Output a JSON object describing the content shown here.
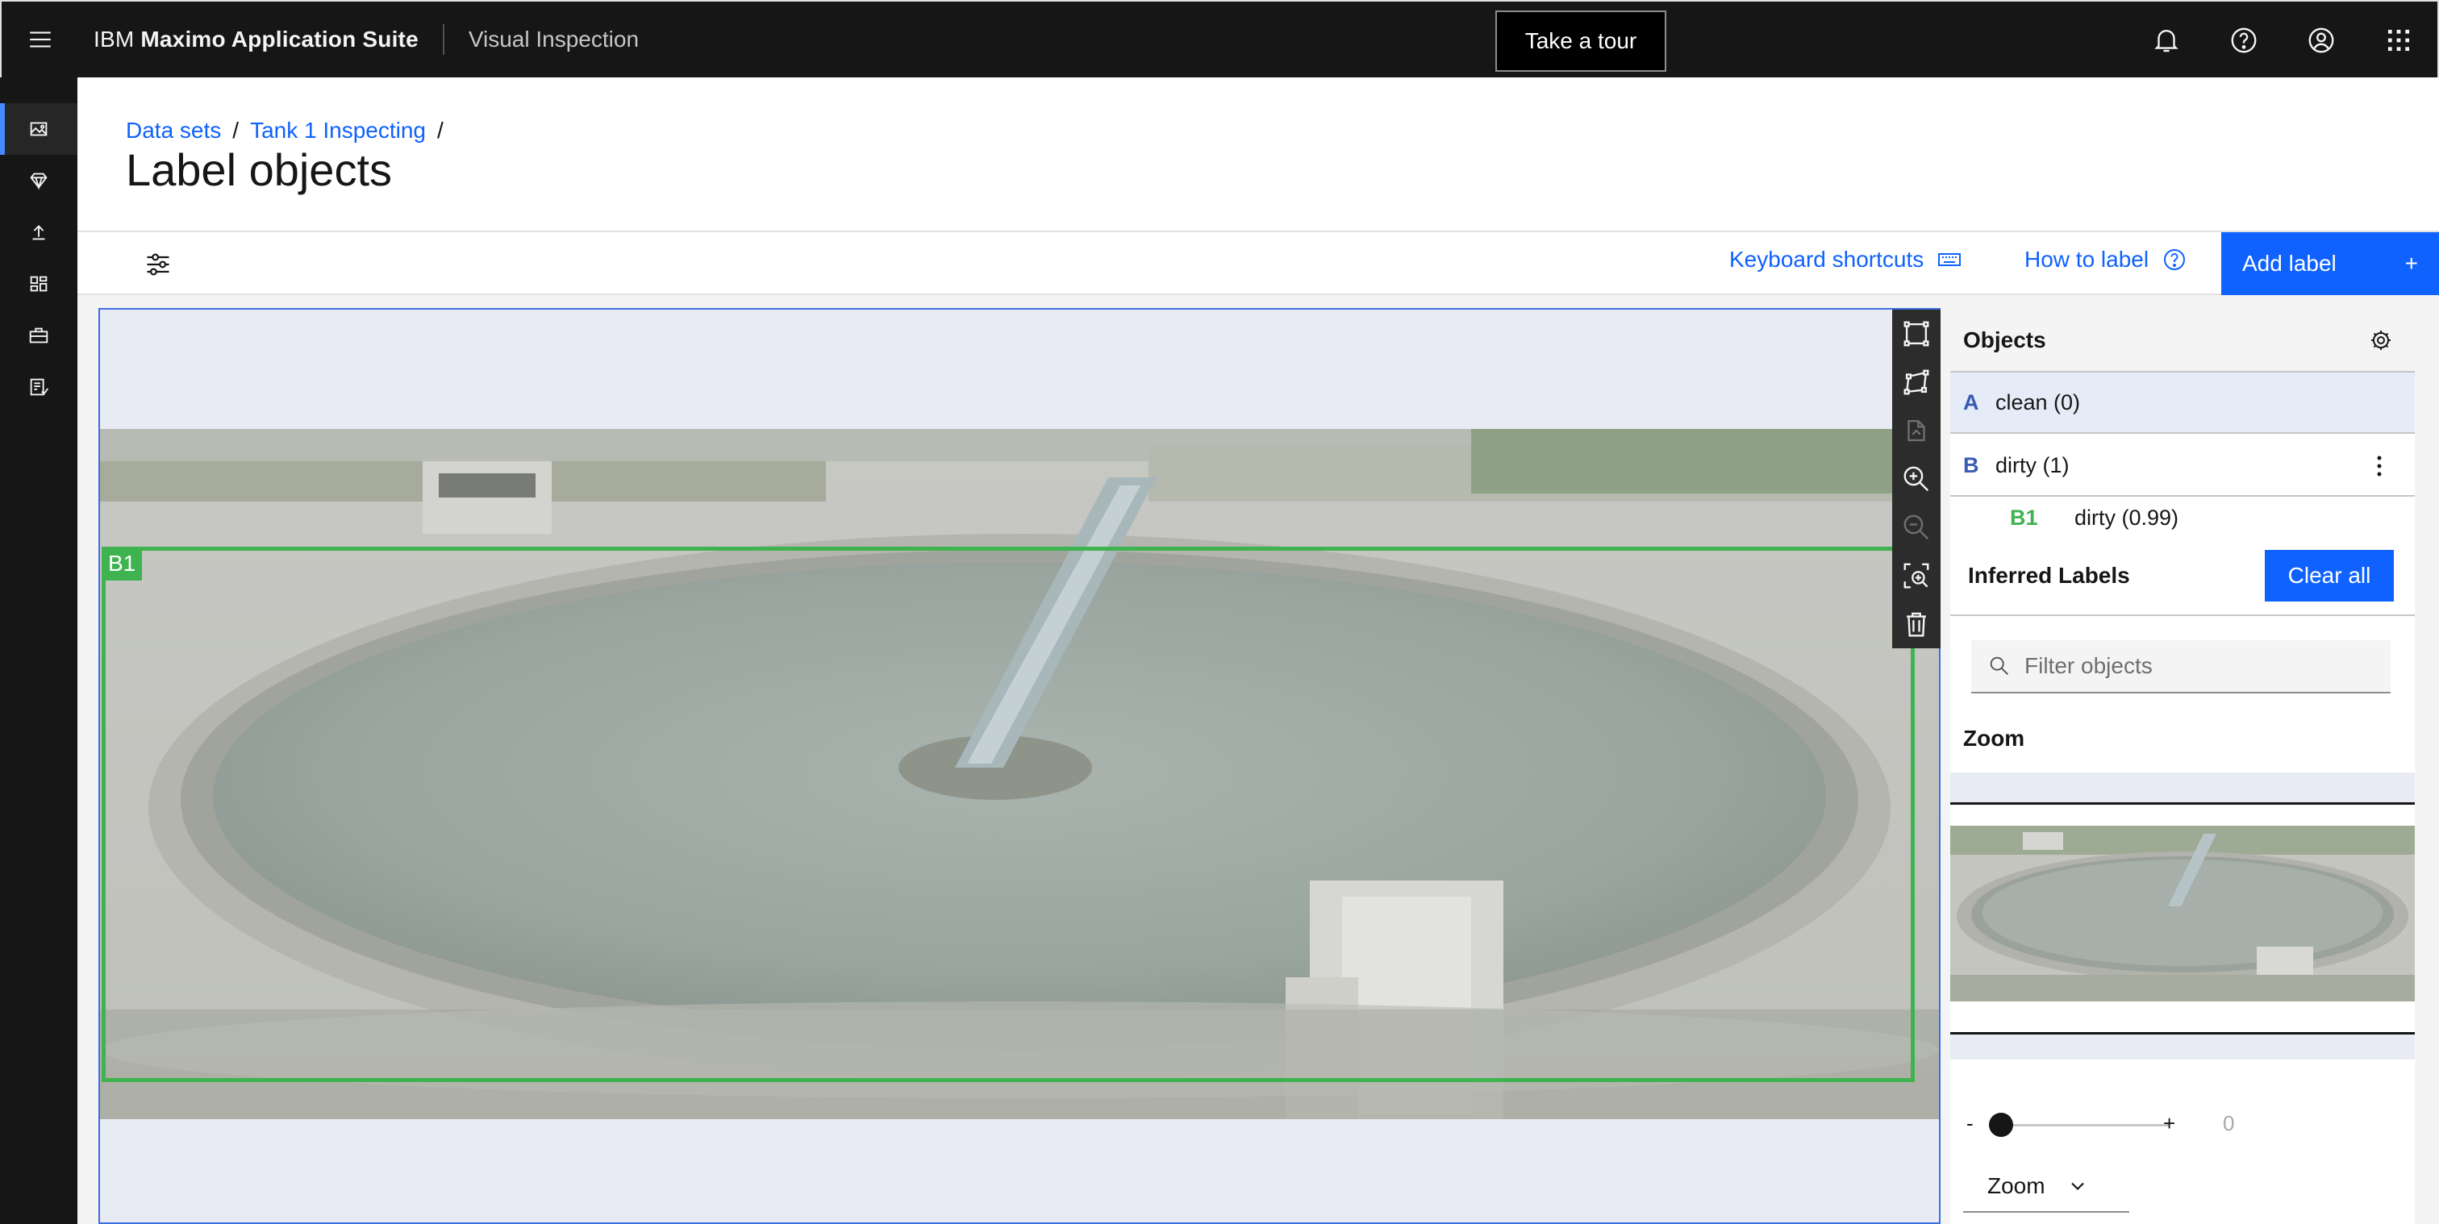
{
  "header": {
    "brand_prefix": "IBM",
    "brand_name": "Maximo Application Suite",
    "product": "Visual Inspection",
    "tour_button": "Take a tour",
    "icons": [
      "bell-icon",
      "help-icon",
      "user-icon",
      "app-switcher-icon"
    ]
  },
  "rail": {
    "icons": [
      "image-gallery-icon",
      "model-diamond-icon",
      "upload-icon",
      "dashboard-icon",
      "toolbox-icon",
      "data-report-icon"
    ],
    "active_index": 0
  },
  "breadcrumb": {
    "items": [
      "Data sets",
      "Tank 1 Inspecting"
    ],
    "separator": "/"
  },
  "page": {
    "title": "Label objects"
  },
  "toolbar": {
    "keyboard_shortcuts": "Keyboard shortcuts",
    "how_to_label": "How to label",
    "add_label": "Add label",
    "add_icon_glyph": "+"
  },
  "canvas": {
    "box_label": "B1",
    "box_color": "#3fb34f",
    "tools": [
      "box-tool-icon",
      "polygon-tool-icon",
      "copy-disabled-icon",
      "zoom-in-icon",
      "zoom-out-icon",
      "fit-zoom-icon",
      "trash-icon"
    ]
  },
  "objects": {
    "title": "Objects",
    "rows": [
      {
        "key": "A",
        "label": "clean (0)"
      },
      {
        "key": "B",
        "label": "dirty (1)"
      }
    ],
    "sub": {
      "key": "B1",
      "label": "dirty (0.99)"
    }
  },
  "inferred": {
    "title": "Inferred Labels",
    "clear_all": "Clear all"
  },
  "filter": {
    "placeholder": "Filter objects"
  },
  "zoom": {
    "title": "Zoom",
    "minus": "-",
    "plus": "+",
    "value": "0",
    "select": "Zoom"
  },
  "colors": {
    "accent": "#0f62fe",
    "topbar": "#161616",
    "box": "#3fb34f"
  }
}
